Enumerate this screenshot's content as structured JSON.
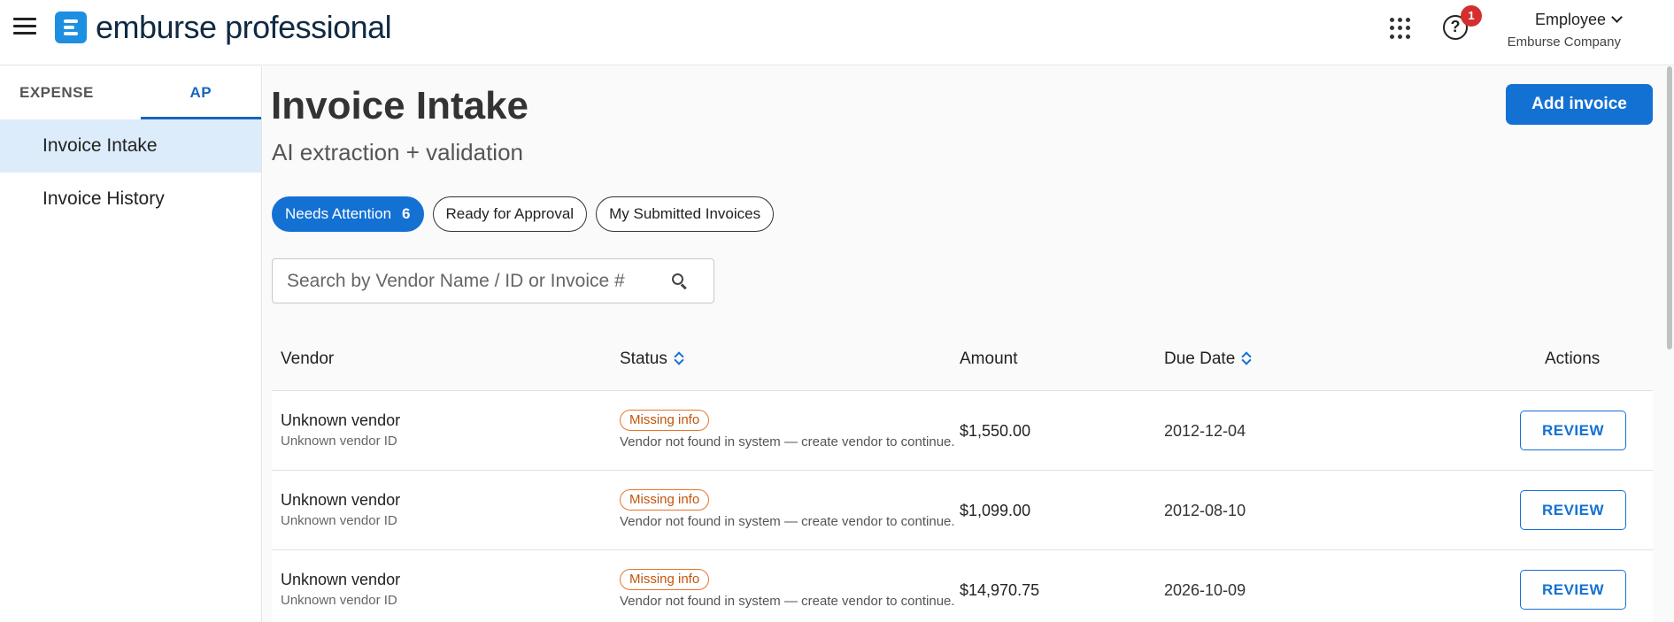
{
  "header": {
    "logo_text": "emburse professional",
    "help_badge_count": "1",
    "user_role": "Employee",
    "company": "Emburse Company"
  },
  "sidebar": {
    "tabs": [
      {
        "label": "EXPENSE"
      },
      {
        "label": "AP"
      }
    ],
    "items": [
      {
        "label": "Invoice Intake"
      },
      {
        "label": "Invoice History"
      }
    ]
  },
  "main": {
    "title": "Invoice Intake",
    "subtitle": "AI extraction + validation",
    "add_button": "Add invoice",
    "filters": [
      {
        "label": "Needs Attention",
        "count": "6"
      },
      {
        "label": "Ready for Approval"
      },
      {
        "label": "My Submitted Invoices"
      }
    ],
    "search_placeholder": "Search by Vendor Name / ID or Invoice #",
    "table": {
      "headers": {
        "vendor": "Vendor",
        "status": "Status",
        "amount": "Amount",
        "due_date": "Due Date",
        "actions": "Actions"
      },
      "rows": [
        {
          "vendor": "Unknown vendor",
          "vendor_id": "Unknown vendor ID",
          "status": "Missing info",
          "status_msg": "Vendor not found in system — create vendor to continue.",
          "amount": "$1,550.00",
          "due_date": "2012-12-04",
          "action": "REVIEW"
        },
        {
          "vendor": "Unknown vendor",
          "vendor_id": "Unknown vendor ID",
          "status": "Missing info",
          "status_msg": "Vendor not found in system — create vendor to continue.",
          "amount": "$1,099.00",
          "due_date": "2012-08-10",
          "action": "REVIEW"
        },
        {
          "vendor": "Unknown vendor",
          "vendor_id": "Unknown vendor ID",
          "status": "Missing info",
          "status_msg": "Vendor not found in system — create vendor to continue.",
          "amount": "$14,970.75",
          "due_date": "2026-10-09",
          "action": "REVIEW"
        }
      ]
    }
  },
  "colors": {
    "primary": "#1471d4",
    "active_nav_bg": "#dcecfb",
    "warning_badge": "#e8742a",
    "notification_badge": "#d32f2f"
  }
}
